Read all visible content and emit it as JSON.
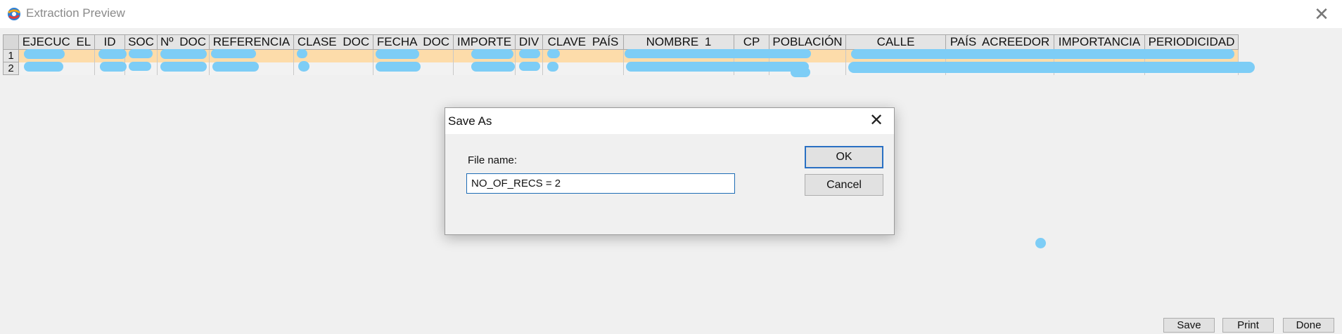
{
  "window": {
    "title": "Extraction Preview",
    "icon": "app-globe-icon",
    "close_icon": "close-icon"
  },
  "grid": {
    "columns": [
      "EJECUC EL",
      "ID",
      "SOC",
      "Nº DOC",
      "REFERENCIA",
      "CLASE DOC",
      "FECHA DOC",
      "IMPORTE",
      "DIV",
      "CLAVE PAÍS",
      "NOMBRE 1",
      "CP",
      "POBLACIÓN",
      "CALLE",
      "PAÍS ACREEDOR",
      "IMPORTANCIA",
      "PERIODICIDAD"
    ],
    "rows": [
      {
        "num": "1",
        "cells": [
          "",
          "",
          "",
          "",
          "",
          "",
          "",
          "",
          "",
          "",
          "",
          "",
          "",
          "",
          "",
          "",
          ""
        ]
      },
      {
        "num": "2",
        "cells": [
          "",
          "",
          "",
          "",
          "",
          "",
          "",
          "",
          "",
          "",
          "",
          "",
          "",
          "",
          "",
          "",
          ""
        ]
      }
    ]
  },
  "dialog": {
    "title": "Save As",
    "file_name_label": "File name:",
    "file_name_value": "NO_OF_RECS = 2",
    "ok_label": "OK",
    "cancel_label": "Cancel"
  },
  "footer": {
    "save_label": "Save",
    "print_label": "Print",
    "done_label": "Done"
  },
  "colors": {
    "row_selected": "#fddcaa",
    "accent": "#2a70c3",
    "redaction": "#7dcdf6"
  }
}
